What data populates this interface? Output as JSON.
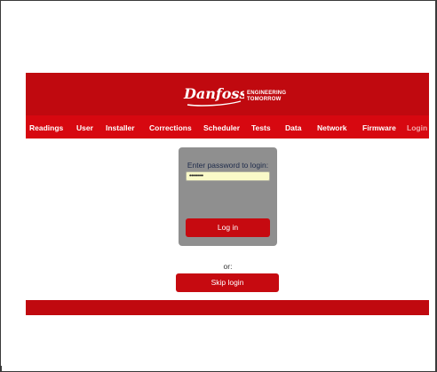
{
  "brand": {
    "logo_text": "Danfoss",
    "tagline_line1": "ENGINEERING",
    "tagline_line2": "TOMORROW",
    "brand_color": "#c0090f"
  },
  "nav": {
    "items": [
      {
        "label": "Readings",
        "active": true
      },
      {
        "label": "User",
        "active": true
      },
      {
        "label": "Installer",
        "active": true
      },
      {
        "label": "Corrections",
        "active": true
      },
      {
        "label": "Scheduler",
        "active": true
      },
      {
        "label": "Tests",
        "active": true
      },
      {
        "label": "Data",
        "active": true
      },
      {
        "label": "Network",
        "active": true
      },
      {
        "label": "Firmware",
        "active": true
      },
      {
        "label": "Login",
        "active": false
      }
    ]
  },
  "login": {
    "prompt": "Enter password to login:",
    "password_value": "••••••••",
    "login_button": "Log in",
    "or_label": "or:",
    "skip_button": "Skip login"
  }
}
